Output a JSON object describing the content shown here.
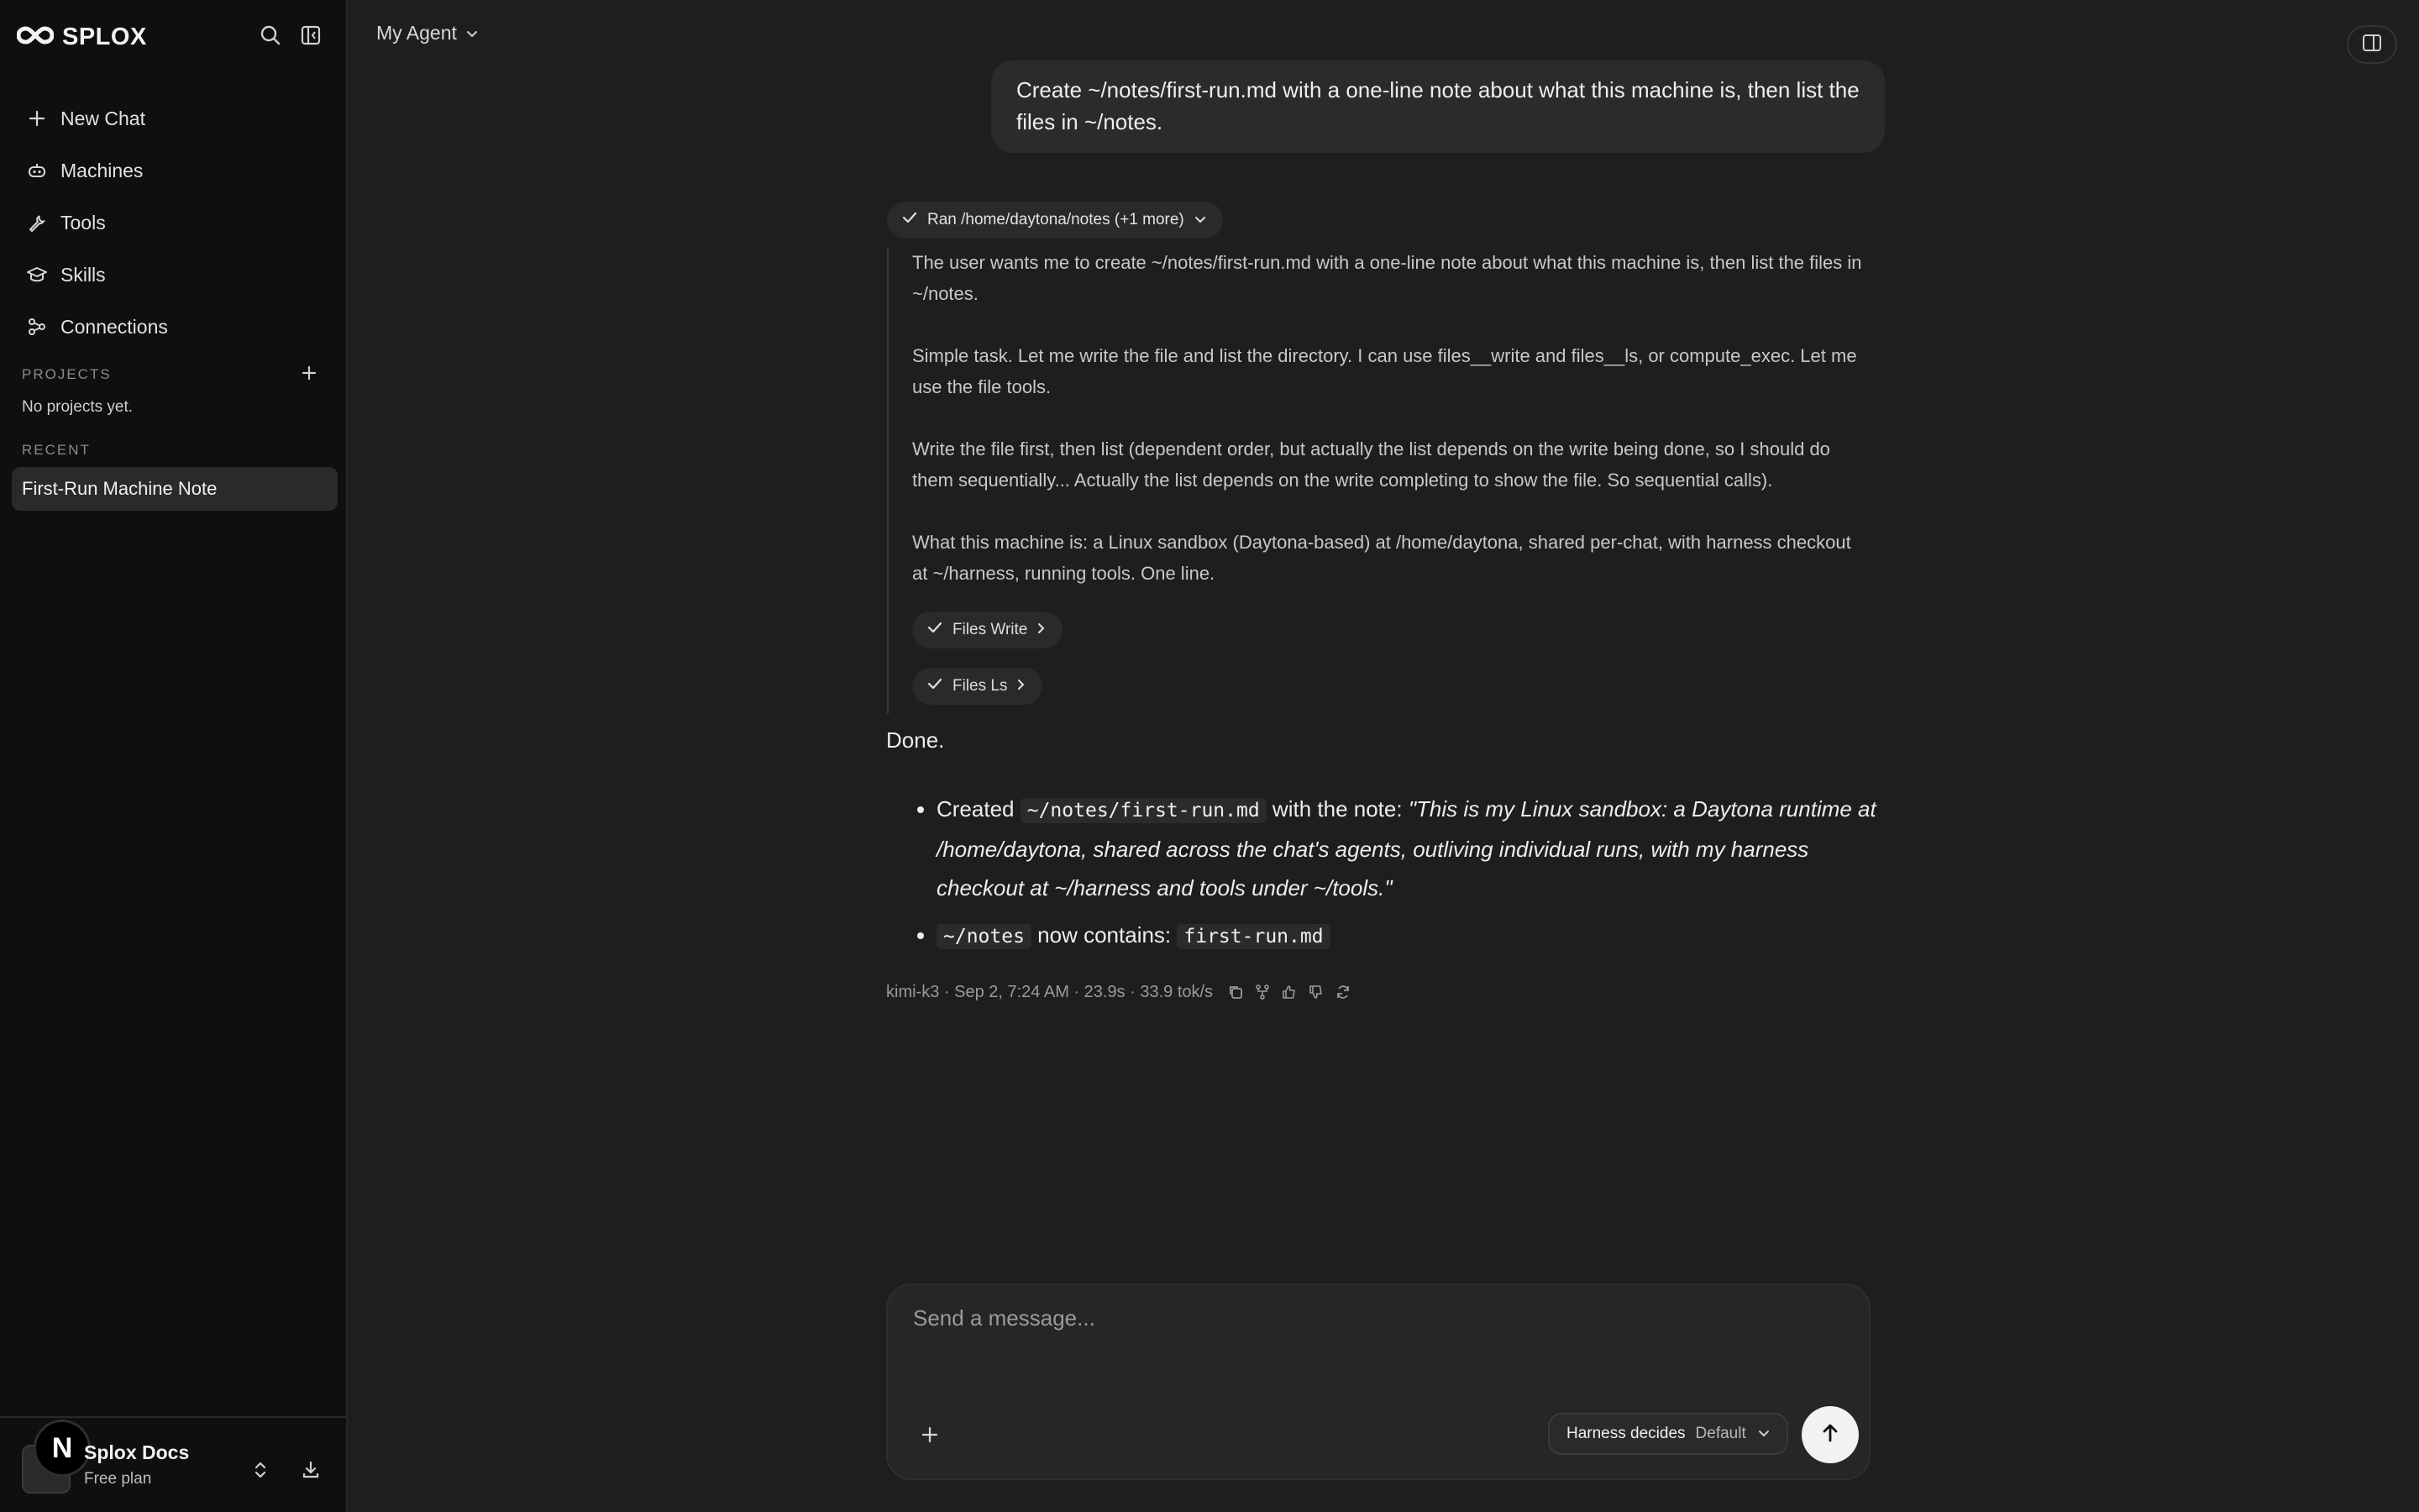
{
  "app": {
    "brand": "SPLOX"
  },
  "sidebar": {
    "nav": [
      {
        "label": "New Chat",
        "icon": "plus-icon"
      },
      {
        "label": "Machines",
        "icon": "robot-icon"
      },
      {
        "label": "Tools",
        "icon": "wrench-icon"
      },
      {
        "label": "Skills",
        "icon": "graduation-cap-icon"
      },
      {
        "label": "Connections",
        "icon": "connections-icon"
      }
    ],
    "projects_label": "PROJECTS",
    "projects_empty": "No projects yet.",
    "recent_label": "RECENT",
    "recent": [
      {
        "label": "First-Run Machine Note"
      }
    ],
    "footer": {
      "avatar_letter": "N",
      "title": "Splox Docs",
      "plan": "Free plan"
    }
  },
  "header": {
    "agent_label": "My Agent"
  },
  "conversation": {
    "user_message": "Create ~/notes/first-run.md with a one-line note about what this machine is, then list the files in ~/notes.",
    "ran_chip": "Ran /home/daytona/notes (+1 more)",
    "thinking": [
      "The user wants me to create ~/notes/first-run.md with a one-line note about what this machine is, then list the files in ~/notes.",
      "Simple task. Let me write the file and list the directory. I can use files__write and files__ls, or compute_exec. Let me use the file tools.",
      "Write the file first, then list (dependent order, but actually the list depends on the write being done, so I should do them sequentially... Actually the list depends on the write completing to show the file. So sequential calls).",
      "What this machine is: a Linux sandbox (Daytona-based) at /home/daytona, shared per-chat, with harness checkout at ~/harness, running tools. One line."
    ],
    "tool_calls": [
      "Files Write",
      "Files Ls"
    ],
    "answer": {
      "intro": "Done.",
      "item1_prefix": "Created",
      "item1_code": "~/notes/first-run.md",
      "item1_mid": "with the note:",
      "item1_quote": "\"This is my Linux sandbox: a Daytona runtime at /home/daytona, shared across the chat's agents, outliving individual runs, with my harness checkout at ~/harness and tools under ~/tools.\"",
      "item2_code": "~/notes",
      "item2_mid": "now contains:",
      "item2_code2": "first-run.md"
    },
    "meta": "kimi-k3 · Sep 2, 7:24 AM · 23.9s · 33.9 tok/s"
  },
  "composer": {
    "placeholder": "Send a message...",
    "mode_label": "Harness decides",
    "mode_value": "Default"
  },
  "colors": {
    "background": "#1e1e1e",
    "sidebar": "#0f0f0f",
    "bubble": "#2b2b2b",
    "send": "#f2f2f2"
  }
}
